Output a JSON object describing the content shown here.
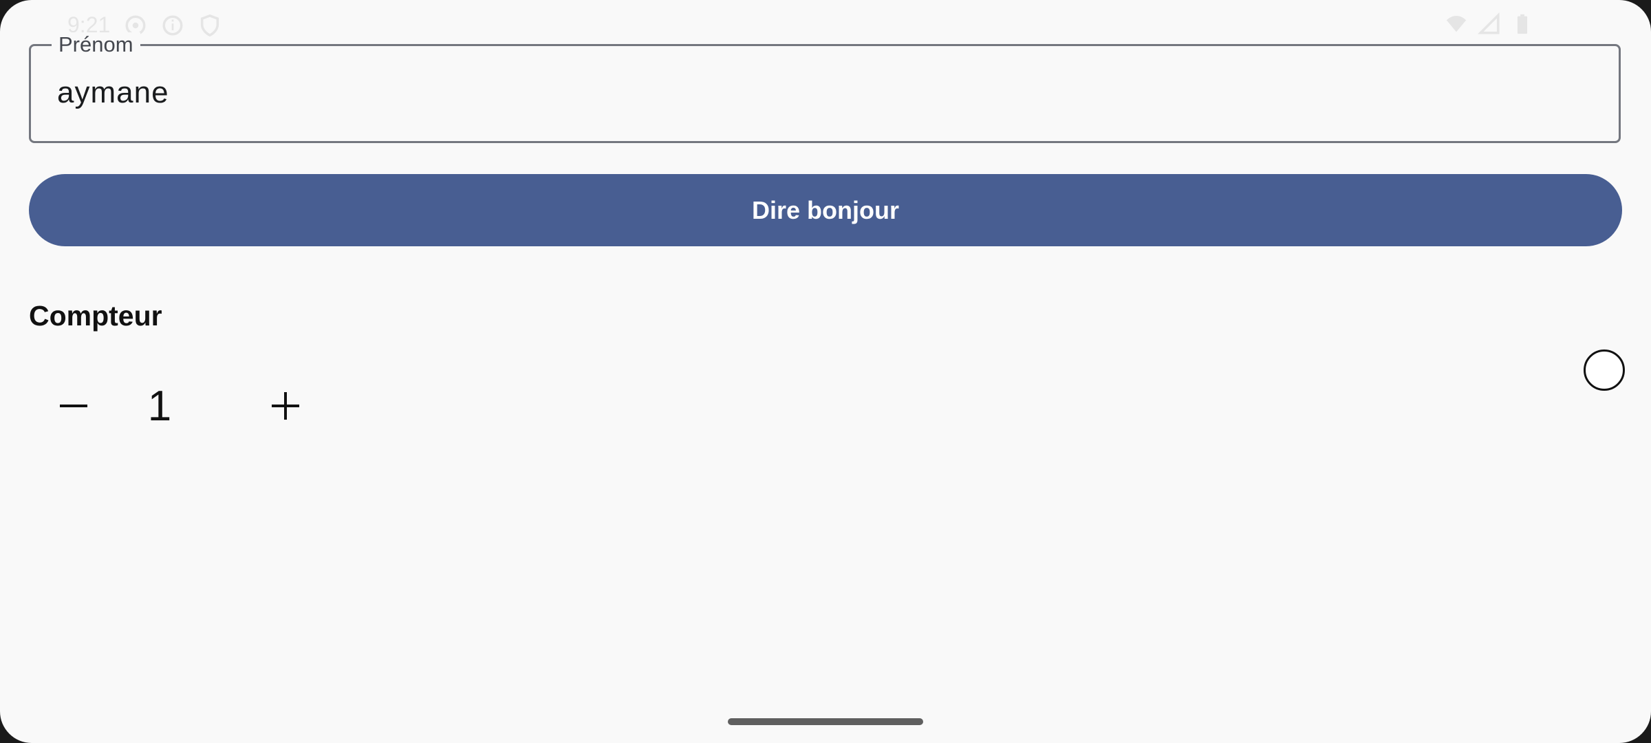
{
  "status_bar": {
    "time": "9:21",
    "left_icons": [
      "location-icon",
      "info-icon",
      "shield-icon"
    ],
    "right_icons": [
      "wifi-icon",
      "signal-icon",
      "battery-icon"
    ]
  },
  "name_field": {
    "label": "Prénom",
    "value": "aymane"
  },
  "greet_button": {
    "label": "Dire bonjour",
    "color": "#485e92"
  },
  "counter": {
    "title": "Compteur",
    "value": "1",
    "decrement_icon": "minus-icon",
    "increment_icon": "plus-icon"
  },
  "radio": {
    "selected": false
  },
  "colors": {
    "background": "#f9f9f9",
    "primary": "#485e92",
    "outline": "#74777f"
  }
}
